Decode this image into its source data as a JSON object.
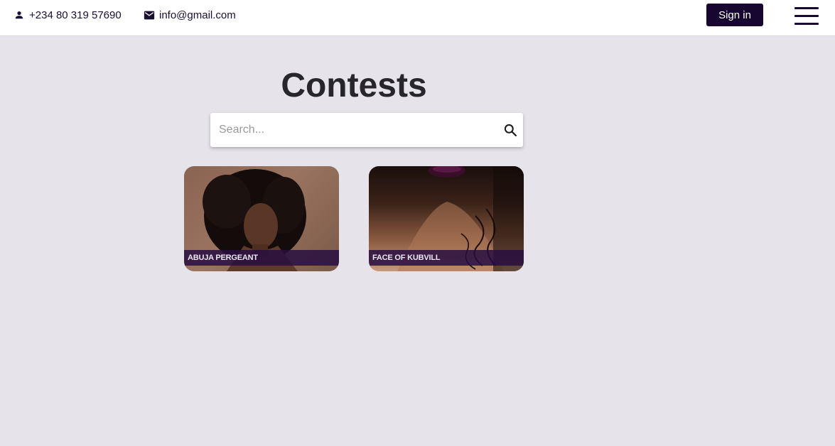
{
  "header": {
    "phone": "+234 80 319 57690",
    "email": "info@gmail.com",
    "signin_label": "Sign in",
    "icons": [
      "person-icon",
      "mail-icon",
      "hamburger-menu-icon"
    ]
  },
  "main": {
    "title": "Contests",
    "search": {
      "placeholder": "Search...",
      "value": "",
      "icon": "search-icon"
    },
    "contests": [
      {
        "label": "ABUJA PERGEANT"
      },
      {
        "label": "FACE OF KUBVILL"
      }
    ]
  },
  "colors": {
    "background": "#e6e3ea",
    "header_bg": "#ffffff",
    "accent": "#170730",
    "card_label_bg": "#280e40"
  }
}
